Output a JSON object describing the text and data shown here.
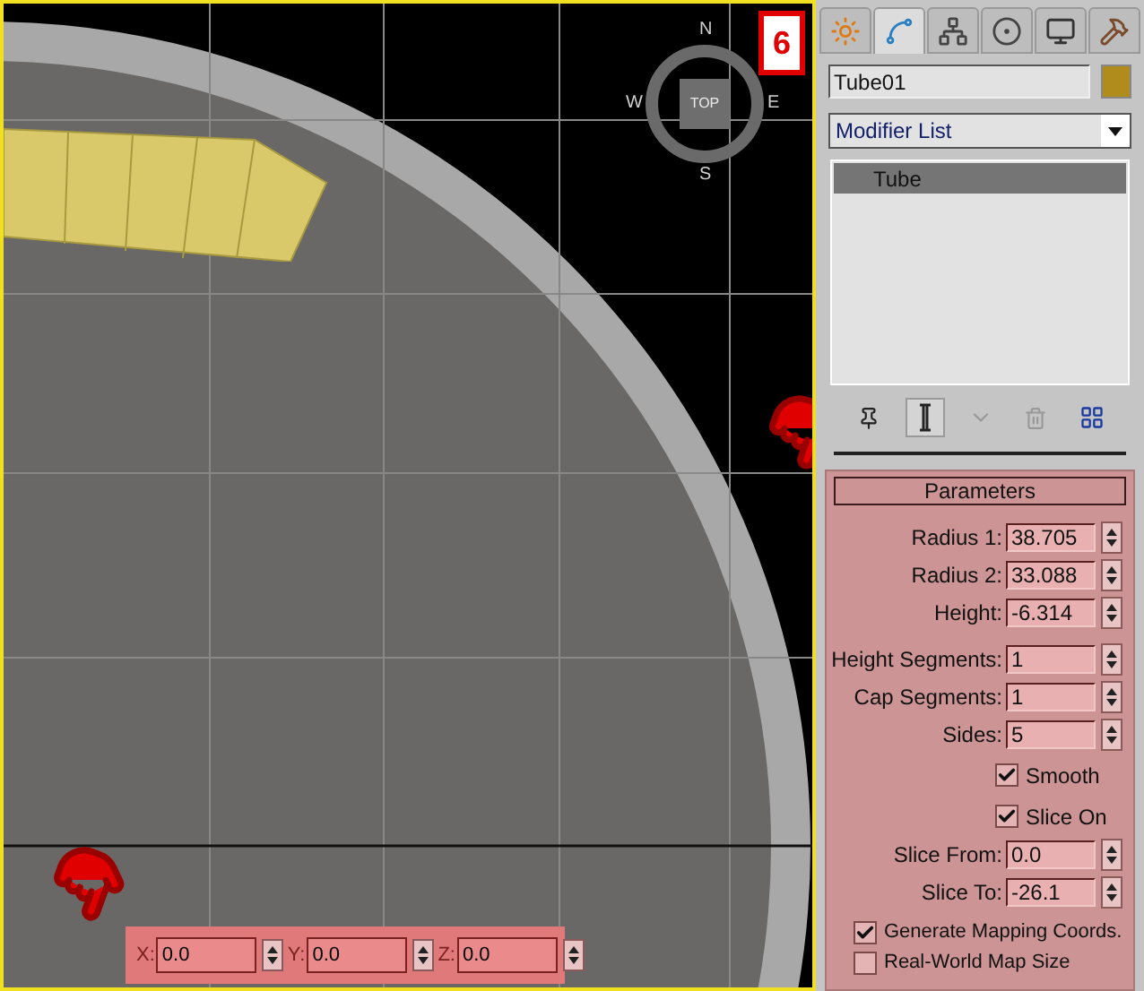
{
  "viewport": {
    "badge": "6",
    "viewcube": {
      "label": "TOP",
      "directions": [
        {
          "kind": "n",
          "label": "N"
        },
        {
          "kind": "e",
          "label": "E"
        },
        {
          "kind": "s",
          "label": "S"
        },
        {
          "kind": "w",
          "label": "W"
        }
      ]
    },
    "coords": [
      {
        "axis": "X:",
        "value": "0.0"
      },
      {
        "axis": "Y:",
        "value": "0.0"
      },
      {
        "axis": "Z:",
        "value": "0.0"
      }
    ]
  },
  "panel": {
    "tabs": [
      {
        "kind": "create",
        "selected": false
      },
      {
        "kind": "modify",
        "selected": true
      },
      {
        "kind": "hierarchy",
        "selected": false
      },
      {
        "kind": "motion",
        "selected": false
      },
      {
        "kind": "display",
        "selected": false
      },
      {
        "kind": "utilities",
        "selected": false
      }
    ],
    "object_name": "Tube01",
    "modifier_list": "Modifier List",
    "stack": [
      {
        "label": "Tube",
        "selected": true
      }
    ],
    "toolbar": [
      {
        "kind": "pin",
        "selected": false
      },
      {
        "kind": "end_result",
        "selected": true
      },
      {
        "kind": "unique",
        "selected": false
      },
      {
        "kind": "remove",
        "selected": false
      },
      {
        "kind": "configure",
        "selected": false
      }
    ],
    "parameters": {
      "title": "Parameters",
      "items": [
        {
          "kind": "spinner",
          "label": "Radius 1:",
          "value": "38.705"
        },
        {
          "kind": "spinner",
          "label": "Radius 2:",
          "value": "33.088"
        },
        {
          "kind": "spinner",
          "label": "Height:",
          "value": "-6.314"
        },
        {
          "kind": "gap"
        },
        {
          "kind": "spinner",
          "label": "Height Segments:",
          "value": "1"
        },
        {
          "kind": "spinner",
          "label": "Cap Segments:",
          "value": "1"
        },
        {
          "kind": "spinner",
          "label": "Sides:",
          "value": "5"
        },
        {
          "kind": "checkbox",
          "label": "Smooth",
          "checked": true
        },
        {
          "kind": "checkbox",
          "label": "Slice On",
          "checked": true
        },
        {
          "kind": "spinner",
          "label": "Slice From:",
          "value": "0.0"
        },
        {
          "kind": "spinner",
          "label": "Slice To:",
          "value": "-26.1"
        }
      ],
      "mapping": [
        {
          "label": "Generate Mapping Coords.",
          "checked": true
        },
        {
          "label": "Real-World Map Size",
          "checked": false
        }
      ]
    }
  }
}
